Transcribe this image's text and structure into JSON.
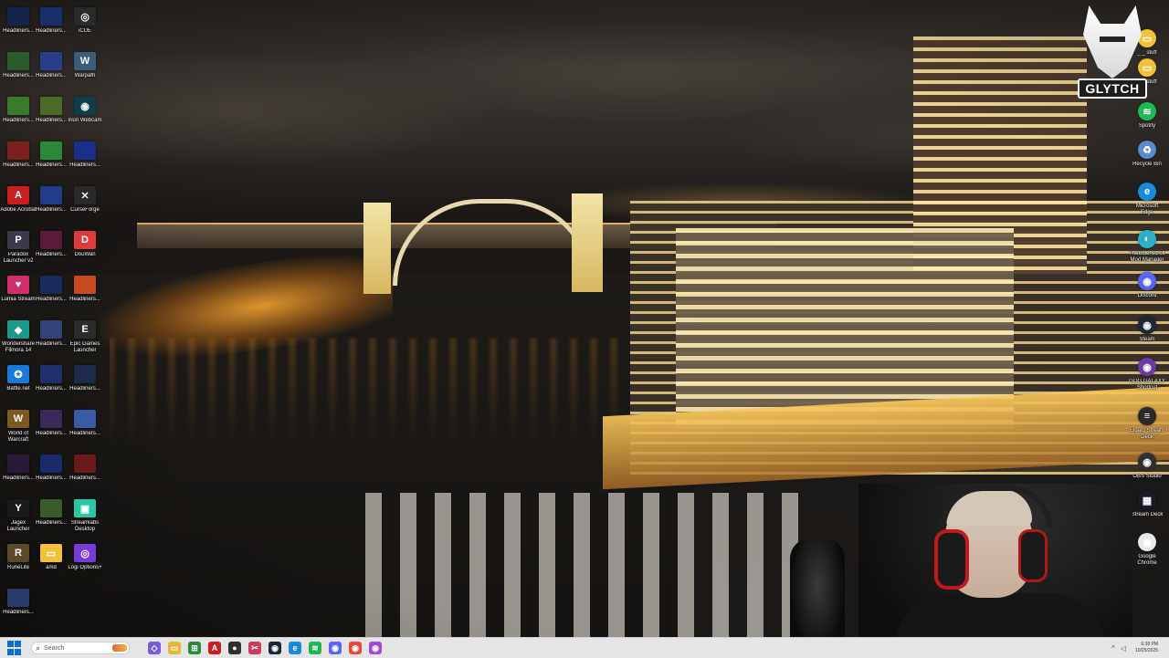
{
  "desktop": {
    "left_icons": [
      {
        "id": "h1",
        "label": "Headliners...",
        "color": "#16234a",
        "glyph": ""
      },
      {
        "id": "h2",
        "label": "Headliners...",
        "color": "#1a2f6a",
        "glyph": ""
      },
      {
        "id": "icue",
        "label": "iCUE",
        "color": "#2a2a2a",
        "glyph": "◎"
      },
      {
        "id": "h3",
        "label": "Headliners...",
        "color": "#2d5a2a",
        "glyph": ""
      },
      {
        "id": "h4",
        "label": "Headliners...",
        "color": "#2a3d8a",
        "glyph": ""
      },
      {
        "id": "warpath",
        "label": "Warpath",
        "color": "#3b5d7a",
        "glyph": "W"
      },
      {
        "id": "h5",
        "label": "Headliners...",
        "color": "#3a7a2e",
        "glyph": ""
      },
      {
        "id": "h6",
        "label": "Headliners...",
        "color": "#4c6a2a",
        "glyph": ""
      },
      {
        "id": "iriun",
        "label": "Iriun Webcam",
        "color": "#0f3d4a",
        "glyph": "◉"
      },
      {
        "id": "h7",
        "label": "Headliners...",
        "color": "#7a2020",
        "glyph": ""
      },
      {
        "id": "h8",
        "label": "Headliners...",
        "color": "#2a8a3a",
        "glyph": ""
      },
      {
        "id": "h9",
        "label": "Headliners...",
        "color": "#1a2f8a",
        "glyph": ""
      },
      {
        "id": "acrobat",
        "label": "Adobe Acrobat",
        "color": "#c8201e",
        "glyph": "A"
      },
      {
        "id": "h10",
        "label": "Headliners...",
        "color": "#223c8a",
        "glyph": ""
      },
      {
        "id": "curseforge",
        "label": "CurseForge",
        "color": "#2a2a2a",
        "glyph": "✕"
      },
      {
        "id": "paradox",
        "label": "Paradox Launcher v2",
        "color": "#3a3a4a",
        "glyph": "P"
      },
      {
        "id": "h11",
        "label": "Headliners...",
        "color": "#5a1a3a",
        "glyph": ""
      },
      {
        "id": "douwan",
        "label": "DouWan",
        "color": "#e03a3a",
        "glyph": "D"
      },
      {
        "id": "lumia",
        "label": "Lumia Stream",
        "color": "#d0306a",
        "glyph": "♥"
      },
      {
        "id": "h12",
        "label": "Headliners...",
        "color": "#1a2a5a",
        "glyph": ""
      },
      {
        "id": "h13",
        "label": "Headliners...",
        "color": "#c84a1e",
        "glyph": ""
      },
      {
        "id": "filmora",
        "label": "Wondershare Filmora 14",
        "color": "#1a9a8a",
        "glyph": "◆"
      },
      {
        "id": "h14",
        "label": "Headliners...",
        "color": "#34427a",
        "glyph": ""
      },
      {
        "id": "epic",
        "label": "Epic Games Launcher",
        "color": "#2b2b2b",
        "glyph": "E"
      },
      {
        "id": "battlenet",
        "label": "Battle.net",
        "color": "#1a7ad8",
        "glyph": "✪"
      },
      {
        "id": "h15",
        "label": "Headliners...",
        "color": "#1f2f6a",
        "glyph": ""
      },
      {
        "id": "h16",
        "label": "Headliners...",
        "color": "#1e2a4a",
        "glyph": ""
      },
      {
        "id": "wow",
        "label": "World of Warcraft",
        "color": "#7a5a20",
        "glyph": "W"
      },
      {
        "id": "h17",
        "label": "Headliners...",
        "color": "#3a2a5a",
        "glyph": ""
      },
      {
        "id": "h18",
        "label": "Headliners...",
        "color": "#3a5aa8",
        "glyph": ""
      },
      {
        "id": "h19",
        "label": "Headliners...",
        "color": "#2a1a3a",
        "glyph": ""
      },
      {
        "id": "h20",
        "label": "Headliners...",
        "color": "#1a2a6a",
        "glyph": ""
      },
      {
        "id": "h21",
        "label": "Headliners...",
        "color": "#6a1a1a",
        "glyph": ""
      },
      {
        "id": "jagex",
        "label": "Jagex Launcher",
        "color": "#1a1a1a",
        "glyph": "Y"
      },
      {
        "id": "h22",
        "label": "Headliners...",
        "color": "#3a5a2a",
        "glyph": ""
      },
      {
        "id": "streamlabs",
        "label": "Streamlabs Desktop",
        "color": "#2ac6a8",
        "glyph": "▣"
      },
      {
        "id": "runelite",
        "label": "RuneLite",
        "color": "#5a4a2a",
        "glyph": "R"
      },
      {
        "id": "amd",
        "label": "amd",
        "color": "#f2c23a",
        "glyph": "▭"
      },
      {
        "id": "logi",
        "label": "Logi Options+",
        "color": "#7a3ad8",
        "glyph": "◎"
      },
      {
        "id": "h23",
        "label": "Headliners...",
        "color": "#2a3a6a",
        "glyph": ""
      }
    ],
    "right_icons": [
      {
        "id": "r1",
        "label": "_ _ stuff",
        "color": "#f2c23a",
        "glyph": "▭"
      },
      {
        "id": "r2",
        "label": "_ _ stuff",
        "color": "#f2c23a",
        "glyph": "▭"
      },
      {
        "id": "spotify",
        "label": "Spotify",
        "color": "#1db954",
        "glyph": "≋"
      },
      {
        "id": "recycle",
        "label": "Recycle Bin",
        "color": "#5a8ad0",
        "glyph": "♻"
      },
      {
        "id": "edge",
        "label": "Microsoft Edge",
        "color": "#1a8ad8",
        "glyph": "e"
      },
      {
        "id": "elderscrolls",
        "label": "TheElderScrolls Mod Manager",
        "color": "#2ab0c8",
        "glyph": "◐"
      },
      {
        "id": "discord",
        "label": "Discord",
        "color": "#5865f2",
        "glyph": "◉"
      },
      {
        "id": "steam",
        "label": "Steam",
        "color": "#1b2838",
        "glyph": "◉"
      },
      {
        "id": "godgame",
        "label": "GOG GALAXY Shortcut",
        "color": "#6a3aa8",
        "glyph": "◉"
      },
      {
        "id": "elgato",
        "label": "Elgato Stream Deck",
        "color": "#2a2a2a",
        "glyph": "≡"
      },
      {
        "id": "obs",
        "label": "OBS Studio",
        "color": "#302e31",
        "glyph": "◉"
      },
      {
        "id": "streamdeck",
        "label": "Stream Deck",
        "color": "#1a1a2a",
        "glyph": "▦"
      },
      {
        "id": "chrome",
        "label": "Google Chrome",
        "color": "#e8e8e8",
        "glyph": "◉"
      }
    ]
  },
  "brand": {
    "text": "GLYTCH"
  },
  "taskbar": {
    "search_placeholder": "Search",
    "apps": [
      {
        "name": "copilot",
        "color": "#7a5ad8",
        "glyph": "◇"
      },
      {
        "name": "file-explorer",
        "color": "#e8b632",
        "glyph": "▭"
      },
      {
        "name": "xbox",
        "color": "#2a8a3a",
        "glyph": "⊞"
      },
      {
        "name": "acrobat",
        "color": "#c8201e",
        "glyph": "A"
      },
      {
        "name": "obs",
        "color": "#302e31",
        "glyph": "●"
      },
      {
        "name": "snipping",
        "color": "#d03a5a",
        "glyph": "✂"
      },
      {
        "name": "steam",
        "color": "#1b2838",
        "glyph": "◉"
      },
      {
        "name": "edge",
        "color": "#1a8ad8",
        "glyph": "e"
      },
      {
        "name": "spotify",
        "color": "#1db954",
        "glyph": "≋"
      },
      {
        "name": "discord",
        "color": "#5865f2",
        "glyph": "◉"
      },
      {
        "name": "chrome",
        "color": "#e84a3a",
        "glyph": "◉"
      },
      {
        "name": "messenger",
        "color": "#a04ad8",
        "glyph": "◉"
      }
    ],
    "time": "6:38 PM",
    "date": "10/25/2025"
  }
}
